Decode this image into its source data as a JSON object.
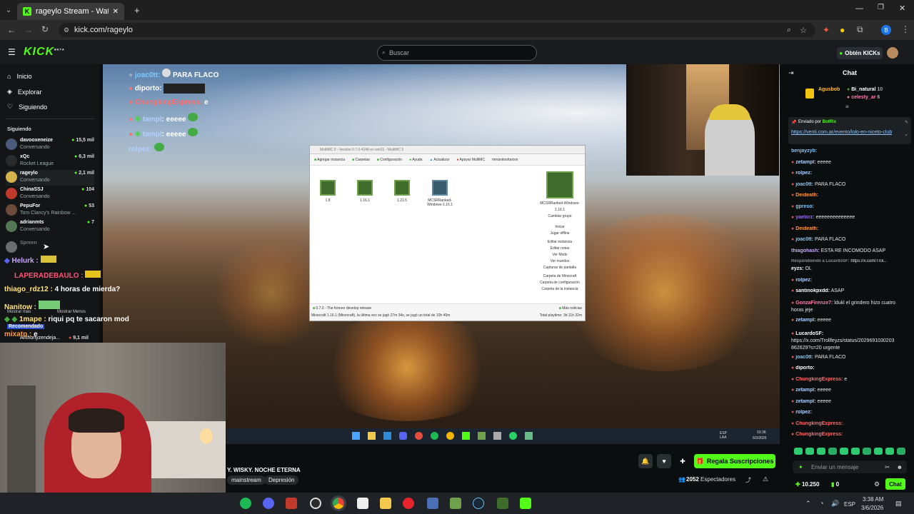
{
  "browser": {
    "tab_title": "rageylo Stream - Watch Live on",
    "url": "kick.com/rageylo",
    "profile_initial": "B"
  },
  "kick": {
    "logo": "KICK",
    "logo_beta": "BETA",
    "search_placeholder": "Buscar",
    "get_kicks": "Obtén KICKs"
  },
  "sidebar": {
    "nav": [
      {
        "label": "Inicio",
        "icon": "home-icon"
      },
      {
        "label": "Explorar",
        "icon": "compass-icon"
      },
      {
        "label": "Siguiendo",
        "icon": "heart-icon"
      }
    ],
    "following_title": "Siguiendo",
    "following": [
      {
        "name": "davooxeneize",
        "category": "Conversando",
        "viewers": "15,5 mil"
      },
      {
        "name": "xQc",
        "category": "Rocket League",
        "viewers": "6,3 mil"
      },
      {
        "name": "rageylo",
        "category": "Conversando",
        "viewers": "2,1 mil"
      },
      {
        "name": "ChinaSSJ",
        "category": "Conversando",
        "viewers": "104"
      },
      {
        "name": "PepuFor",
        "category": "Tom Clancy's Rainbow ...",
        "viewers": "53"
      },
      {
        "name": "adrianmts",
        "category": "Conversando",
        "viewers": "7"
      },
      {
        "name": "Spreen",
        "category": "",
        "viewers": ""
      }
    ],
    "show_more": "Mostrar más",
    "show_less": "Mostrar Menos",
    "recommended": "Recomendado",
    "recommended_item": {
      "name": "Anthonyzendeja...",
      "viewers": "9,1 mil"
    }
  },
  "overlay_chat": [
    {
      "user": "joac0tt:",
      "msg": "PARA FLACO",
      "color": "#7ec8ff"
    },
    {
      "user": "diporto:",
      "msg": "",
      "color": "#ffffff"
    },
    {
      "user": "ChungkingExpress:",
      "msg": "e",
      "color": "#ff6b6b"
    },
    {
      "user": "tampl",
      "msg": ": eeeee",
      "color": "#b0d0ff"
    },
    {
      "user": "tampl",
      "msg": ": eeeee",
      "color": "#b0d0ff"
    },
    {
      "user": "rolpez:",
      "msg": "",
      "color": "#b0d0ff"
    }
  ],
  "left_chat": [
    {
      "user": "Helurk :",
      "msg": "",
      "color": "#c9a7ff"
    },
    {
      "user": "LAPERADEBAULO :",
      "msg": "",
      "color": "#ff5577"
    },
    {
      "user": "thiago_rdz12 :",
      "msg": "4 horas de mierda?",
      "color": "#ffe37a"
    },
    {
      "user": "Nanitow :",
      "msg": "",
      "color": "#ffe37a"
    },
    {
      "user": "1mape :",
      "msg": "riqui pq te sacaron mod",
      "color": "#ffe37a"
    },
    {
      "user": "mixatp :",
      "msg": "e",
      "color": "#ff9a3a"
    }
  ],
  "multimc": {
    "title": "MultiMC 5 - Versión 0.7.0-4248 en win32 - MultiMC 5",
    "toolbar": [
      "Agregar instancia",
      "Carpetas",
      "Configuración",
      "Ayuda",
      "Actualizar",
      "Apoyar MultiMC",
      "mmanitooitarixin"
    ],
    "instances": [
      "1.8",
      "1.16.1",
      "1.21.5",
      "MCSRRanked-Windows-1.16.1"
    ],
    "selected_title": "MCSRRanked-Windows-1.16.1",
    "side_actions": [
      "Cambiar grupo",
      "Iniciar",
      "Jugar offline",
      "Editar instancia",
      "Editar notas",
      "Ver Mods",
      "Ver mundos",
      "Capturas de pantalla",
      "Carpeta de Minecraft",
      "Carpeta de configuración",
      "Carpeta de la instancia"
    ],
    "news": "0.7.0 - The forever develop release",
    "more_news": "Más noticias",
    "status": "Minecraft 1.16.1 (Minecraft), la última vez se jugó 27m 34s, se jugó un total de 10h 40m",
    "total_playtime": "Total playtime: 3d 11h 32m"
  },
  "inner_taskbar": {
    "lang": "ESP LAA",
    "time": "03:38",
    "date": "6/3/2026"
  },
  "stream": {
    "title": "Y. WISKY. NOCHE ETERNA",
    "tags": [
      "mainstream",
      "Depresión"
    ],
    "subscribe_button": "Regala Suscripciones",
    "viewers": "2052",
    "viewers_label": "Espectadores"
  },
  "chat": {
    "title": "Chat",
    "top_users": [
      {
        "name": "Agusbob",
        "count": "",
        "color": "#ffbf3a"
      },
      {
        "name": "Bi_natural",
        "count": "10",
        "color": "#ffffff"
      },
      {
        "name": "celesty_ar",
        "count": "6",
        "color": "#ff7fa8"
      }
    ],
    "pinned_by_label": "Enviado por",
    "pinned_by": "BotRix",
    "pinned_link": "https://venti.com.ar/evento/lolo-en-niceto-club",
    "messages": [
      {
        "user": "benjayzyb:",
        "msg": "",
        "color": "#7ec8ff"
      },
      {
        "user": "zetampl:",
        "msg": "eeeee",
        "color": "#b0d0ff"
      },
      {
        "user": "rolpez:",
        "msg": "",
        "color": "#b0d0ff"
      },
      {
        "user": "joac0tt:",
        "msg": "PARA FLACO",
        "color": "#7ec8ff"
      },
      {
        "user": "Deideath:",
        "msg": "",
        "color": "#ff9a3a"
      },
      {
        "user": "gpreso:",
        "msg": "",
        "color": "#7ec8ff"
      },
      {
        "user": "yaelorz:",
        "msg": "eeeeeeeeeeeeee",
        "color": "#9b6bff"
      },
      {
        "user": "Deideath:",
        "msg": "",
        "color": "#ff9a3a"
      },
      {
        "user": "joac0tt:",
        "msg": "PARA FLACO",
        "color": "#7ec8ff"
      },
      {
        "user": "thiagohash:",
        "msg": "ESTA RE INCOMODO ASAP",
        "color": "#c9a7ff"
      },
      {
        "user": "Respondiendo a LucardoSF:",
        "msg": "https://x.com/Trol...",
        "color": "#8a8f94"
      },
      {
        "user": "eyzs:",
        "msg": "OL",
        "color": "#ffffff"
      },
      {
        "user": "rolpez:",
        "msg": "",
        "color": "#b0d0ff"
      },
      {
        "user": "santinokpxdd:",
        "msg": "ASAP",
        "color": "#ffffff"
      },
      {
        "user": "GonzaFirenze7:",
        "msg": "ldukl el grindero hizo cuatro horas jeje",
        "color": "#ff7fa8"
      },
      {
        "user": "zetampl:",
        "msg": "eeeee",
        "color": "#b0d0ff"
      },
      {
        "user": "LucardoSF:",
        "msg": "https://x.com/Trollfeyzs/status/2029691030203 862629?s=20 urgente",
        "color": "#ffffff"
      },
      {
        "user": "joac0tt:",
        "msg": "PARA FLACO",
        "color": "#7ec8ff"
      },
      {
        "user": "diporto:",
        "msg": "",
        "color": "#ffffff"
      },
      {
        "user": "ChungkingExpress:",
        "msg": "e",
        "color": "#ff6b6b"
      },
      {
        "user": "zetampl:",
        "msg": "eeeee",
        "color": "#b0d0ff"
      },
      {
        "user": "zetampl:",
        "msg": "eeeee",
        "color": "#b0d0ff"
      },
      {
        "user": "rolpez:",
        "msg": "",
        "color": "#b0d0ff"
      },
      {
        "user": "ChungkingExpress:",
        "msg": "",
        "color": "#ff6b6b"
      },
      {
        "user": "ChungkingExpress:",
        "msg": "",
        "color": "#ff6b6b"
      }
    ],
    "input_placeholder": "Enviar un mensaje",
    "points": "10.250",
    "zero": "0",
    "send_label": "Chat"
  },
  "system": {
    "lang": "ESP",
    "time": "3:38 AM",
    "date": "3/6/2026"
  },
  "accent": "#53fc18"
}
